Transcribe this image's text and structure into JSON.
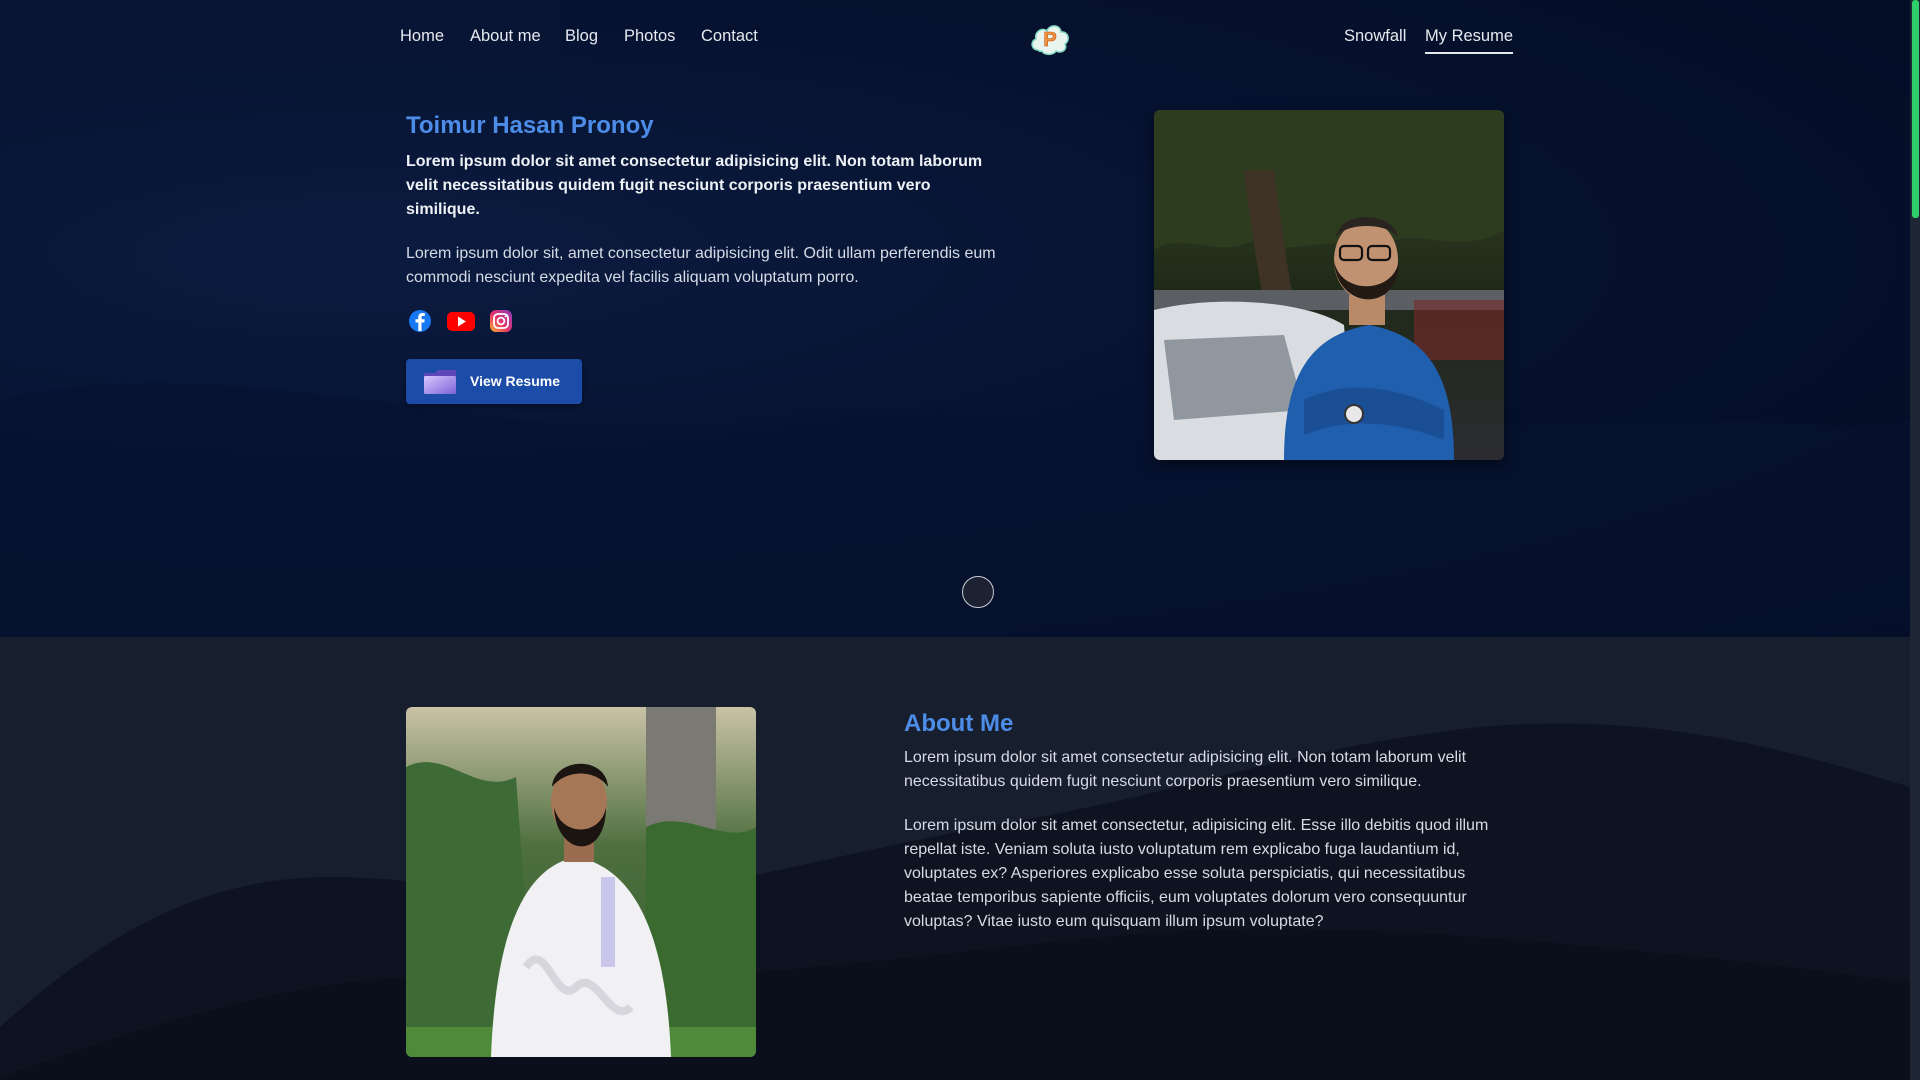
{
  "nav": {
    "left_items": [
      {
        "label": "Home"
      },
      {
        "label": "About me"
      },
      {
        "label": "Blog"
      },
      {
        "label": "Photos"
      },
      {
        "label": "Contact"
      }
    ],
    "logo_letter": "P",
    "right_items": [
      {
        "label": "Snowfall"
      },
      {
        "label": "My Resume"
      }
    ],
    "active_item": "My Resume"
  },
  "hero": {
    "name": "Toimur Hasan Pronoy",
    "lead": "Lorem ipsum dolor sit amet consectetur adipisicing elit. Non totam laborum velit necessitatibus quidem fugit nesciunt corporis praesentium vero similique.",
    "body": "Lorem ipsum dolor sit, amet consectetur adipisicing elit. Odit ullam perferendis eum commodi nesciunt expedita vel facilis aliquam voluptatum porro.",
    "socials": [
      "facebook-icon",
      "youtube-icon",
      "instagram-icon"
    ],
    "resume_button_label": "View Resume"
  },
  "about": {
    "title": "About Me",
    "paragraph1": "Lorem ipsum dolor sit amet consectetur adipisicing elit. Non totam laborum velit necessitatibus quidem fugit nesciunt corporis praesentium vero similique.",
    "paragraph2": "Lorem ipsum dolor sit amet consectetur, adipisicing elit. Esse illo debitis quod illum repellat iste. Veniam soluta iusto voluptatum rem explicabo fuga laudantium id, voluptates ex? Asperiores explicabo esse soluta perspiciatis, qui necessitatibus beatae temporibus sapiente officiis, eum voluptates dolorum vero consequuntur voluptas? Vitae iusto eum quisquam illum ipsum voluptate?"
  },
  "colors": {
    "accent": "#4d8de8",
    "button": "#1b4da8",
    "hero_bg": "#061230",
    "about_bg": "#171e2e",
    "scroll_thumb": "#2ecf6a"
  }
}
